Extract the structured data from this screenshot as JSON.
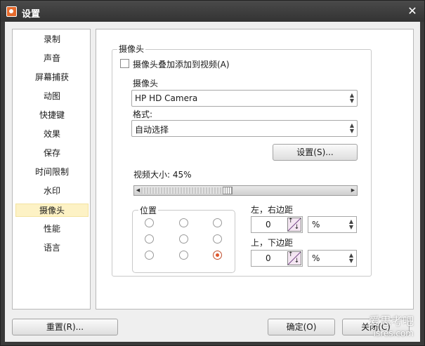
{
  "window": {
    "title": "设置",
    "close_symbol": "✕"
  },
  "sidebar": {
    "items": [
      {
        "label": "录制"
      },
      {
        "label": "声音"
      },
      {
        "label": "屏幕捕获"
      },
      {
        "label": "动图"
      },
      {
        "label": "快捷键"
      },
      {
        "label": "效果"
      },
      {
        "label": "保存"
      },
      {
        "label": "时间限制"
      },
      {
        "label": "水印"
      },
      {
        "label": "摄像头",
        "active": true
      },
      {
        "label": "性能"
      },
      {
        "label": "语言"
      }
    ]
  },
  "camera_panel": {
    "group_title": "摄像头",
    "overlay_checkbox": {
      "label": "摄像头叠加添加到视频(A)",
      "checked": false
    },
    "camera_label": "摄像头",
    "camera_select": {
      "value": "HP HD Camera"
    },
    "format_label": "格式:",
    "format_select": {
      "value": "自动选择"
    },
    "settings_button": "设置(S)...",
    "video_size_label": "视频大小: 45%",
    "video_size_percent": 45,
    "position": {
      "label": "位置",
      "selected_index": 8
    },
    "lr_margin": {
      "label": "左，右边距",
      "value": "0",
      "unit": "%"
    },
    "tb_margin": {
      "label": "上，下边距",
      "value": "0",
      "unit": "%"
    }
  },
  "footer": {
    "reset_button": "重置(R)...",
    "ok_button": "确定(O)",
    "cancel_button": "关闭(C)"
  },
  "watermark": {
    "line1": "爱思考吧",
    "line2": "isres.com"
  }
}
